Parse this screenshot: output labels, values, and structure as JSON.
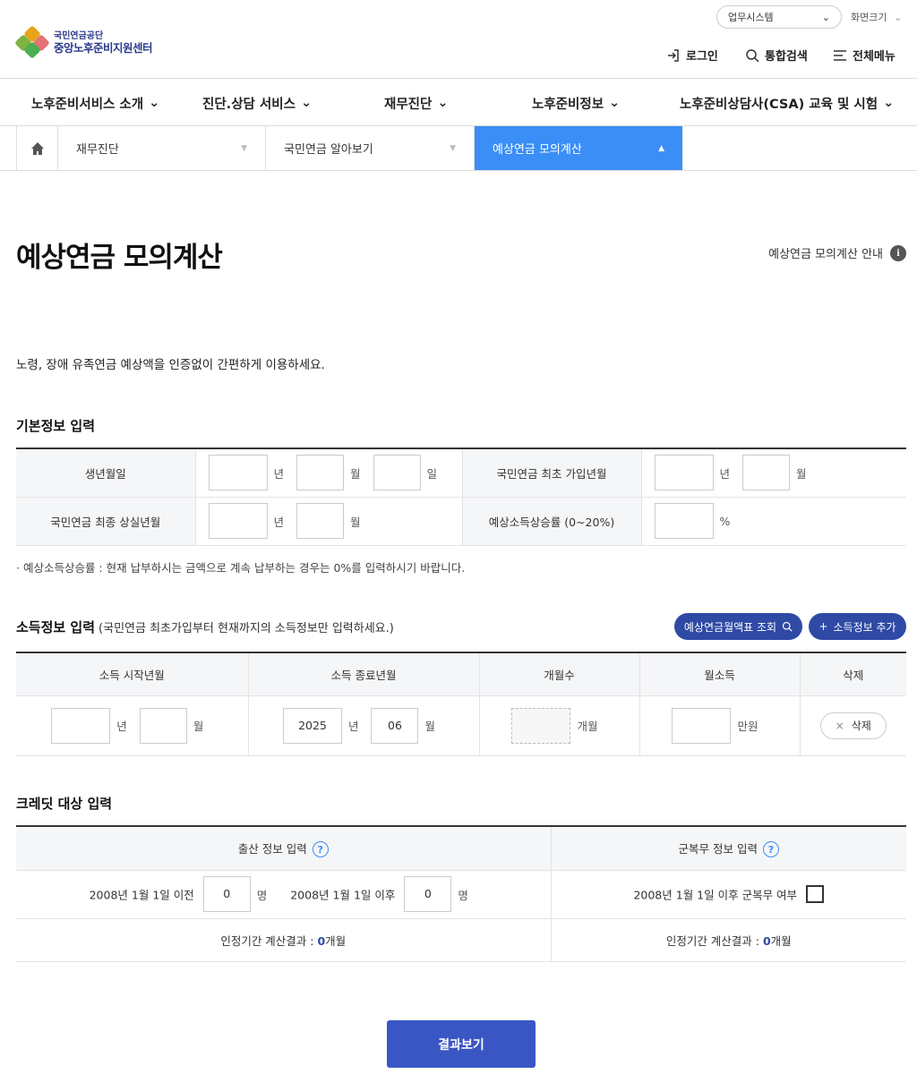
{
  "header": {
    "logo_line1": "국민연금공단",
    "logo_line2": "중앙노후준비지원센터",
    "business_system": "업무시스템",
    "screen_size": "화면크기",
    "login": "로그인",
    "search": "통합검색",
    "all_menu": "전체메뉴"
  },
  "gnb": [
    {
      "label": "노후준비서비스 소개"
    },
    {
      "label": "진단.상담 서비스"
    },
    {
      "label": "재무진단"
    },
    {
      "label": "노후준비정보"
    },
    {
      "label": "노후준비상담사(CSA) 교육 및 시험"
    }
  ],
  "breadcrumb": {
    "level1": "재무진단",
    "level2": "국민연금 알아보기",
    "level3": "예상연금 모의계산"
  },
  "page": {
    "title": "예상연금 모의계산",
    "guide_link": "예상연금 모의계산 안내",
    "description": "노령, 장애 유족연금 예상액을 인증없이 간편하게 이용하세요."
  },
  "basic_info": {
    "section_title": "기본정보 입력",
    "birth_label": "생년월일",
    "first_join_label": "국민연금 최초 가입년월",
    "last_loss_label": "국민연금 최종 상실년월",
    "income_rate_label": "예상소득상승률 (0~20%)",
    "unit_year": "년",
    "unit_month": "월",
    "unit_day": "일",
    "unit_percent": "%",
    "note": "예상소득상승률 : 현재 납부하시는 금액으로 계속 납부하는 경우는 0%를 입력하시기 바랍니다."
  },
  "income_info": {
    "section_title": "소득정보 입력",
    "section_sub": "(국민연금 최초가입부터 현재까지의 소득정보만 입력하세요.)",
    "lookup_button": "예상연금월액표 조회",
    "add_button": "소득정보 추가",
    "columns": [
      "소득 시작년월",
      "소득 종료년월",
      "개월수",
      "월소득",
      "삭제"
    ],
    "row": {
      "start_year": "",
      "start_month": "",
      "end_year": "2025",
      "end_month": "06",
      "months": "",
      "monthly_income": "",
      "unit_year": "년",
      "unit_month": "월",
      "unit_months": "개월",
      "unit_income": "만원",
      "delete_label": "삭제"
    }
  },
  "credit_info": {
    "section_title": "크레딧 대상 입력",
    "birth_header": "출산 정보 입력",
    "military_header": "군복무 정보 입력",
    "before_label": "2008년 1월 1일 이전",
    "before_value": "0",
    "after_label": "2008년 1월 1일 이후",
    "after_value": "0",
    "unit_person": "명",
    "military_label": "2008년 1월 1일 이후 군복무 여부",
    "result_label": "인정기간 계산결과 : ",
    "birth_result_value": "0",
    "military_result_value": "0",
    "result_unit": "개월"
  },
  "submit_label": "결과보기"
}
